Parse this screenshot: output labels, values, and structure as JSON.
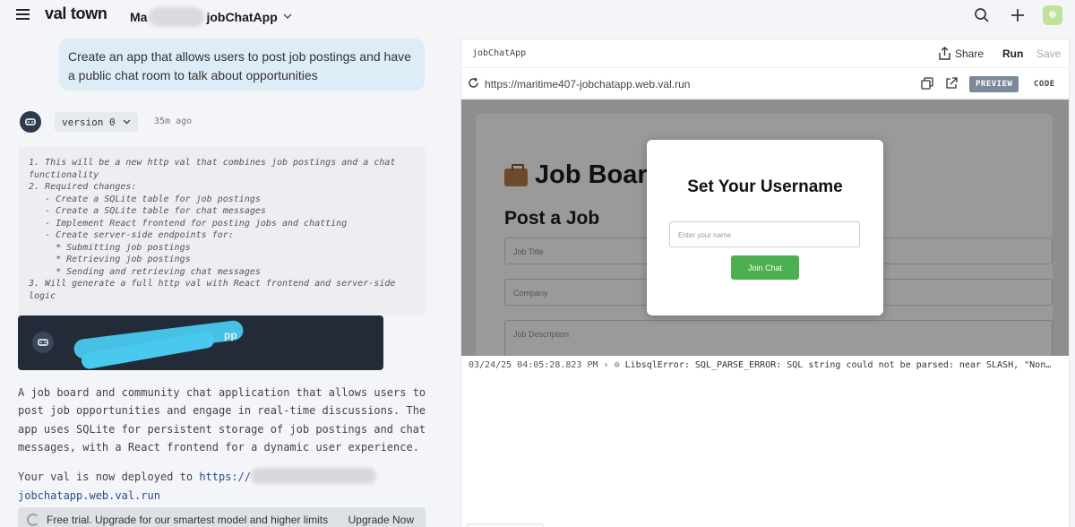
{
  "header": {
    "brand": "val town",
    "project_prefix": "Ma",
    "project_suffix": "jobChatApp",
    "icons": [
      "menu-icon",
      "chevron-down-icon",
      "search-icon",
      "plus-icon",
      "avatar"
    ]
  },
  "chat": {
    "user_message": "Create an app that allows users to post job postings and have a public chat room to talk about opportunities",
    "version_label": "version 0",
    "time_ago": "35m ago",
    "plan_lines": [
      "1. This will be a new http val that combines job postings and a chat",
      "functionality",
      "2. Required changes:",
      "   - Create a SQLite table for job postings",
      "   - Create a SQLite table for chat messages",
      "   - Implement React frontend for posting jobs and chatting",
      "   - Create server-side endpoints for:",
      "     * Submitting job postings",
      "     * Retrieving job postings",
      "     * Sending and retrieving chat messages",
      "3. Will generate a full http val with React frontend and server-side",
      "logic"
    ],
    "val_card_name_tail": "pp",
    "summary": "A job board and community chat application that allows users to post job opportunities and engage in real-time discussions. The app uses SQLite for persistent storage of job postings and chat messages, with a React frontend for a dynamic user experience.",
    "deployed_prefix": "Your val is now deployed to",
    "deployed_link_start": "https://",
    "deployed_link_end": "jobchatapp.web.val.run",
    "trial_text": "Free trial. Upgrade for our smartest model and higher limits",
    "upgrade_label": "Upgrade Now"
  },
  "panel": {
    "title": "jobChatApp",
    "share_label": "Share",
    "run_label": "Run",
    "save_label": "Save",
    "url": "https://maritime407-jobchatapp.web.val.run",
    "preview_label": "PREVIEW",
    "code_label": "CODE"
  },
  "app": {
    "heading": "Job Board",
    "subheading": "Post a Job",
    "fields": [
      "Job Title",
      "Company",
      "Job Description"
    ],
    "modal_title": "Set Your Username",
    "modal_placeholder": "Enter your name",
    "join_label": "Join Chat"
  },
  "console": {
    "timestamp": "03/24/25 04:05:28.823 PM",
    "message": "LibsqlError: SQL_PARSE_ERROR: SQL string could not be parsed: near SLASH, \"Non…"
  },
  "colors": {
    "accent_green": "#4caf50",
    "user_bubble": "#dcedf8",
    "card_dark": "#232b38",
    "link": "#2a4d8a"
  }
}
